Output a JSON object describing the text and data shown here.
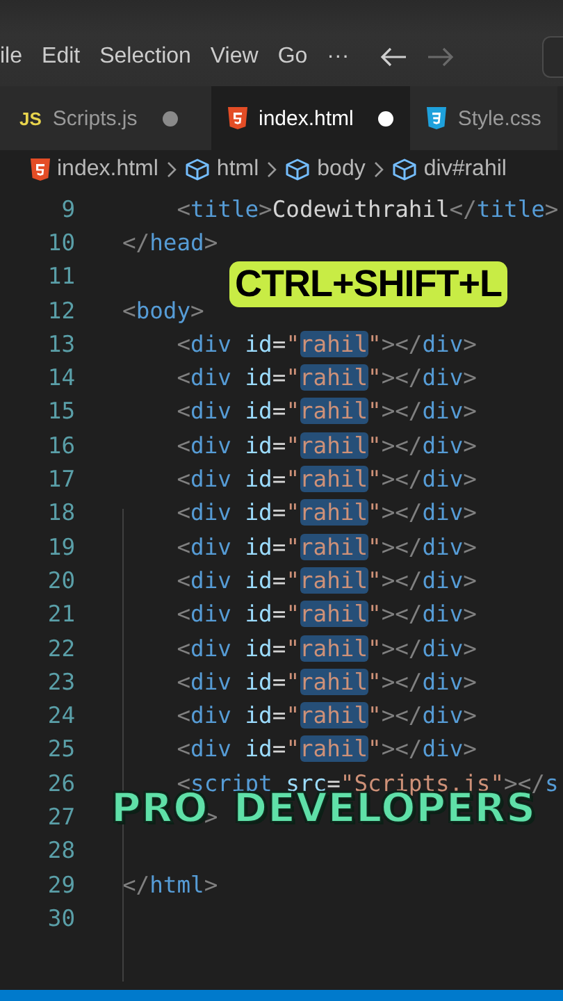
{
  "menu": {
    "items": [
      "ile",
      "Edit",
      "Selection",
      "View",
      "Go",
      "···"
    ],
    "back_enabled": true,
    "forward_enabled": false
  },
  "tabs": [
    {
      "label": "Scripts.js",
      "icon_text": "JS",
      "kind": "js",
      "selected": false,
      "modified": true
    },
    {
      "label": "index.html",
      "kind": "html",
      "selected": true,
      "modified": true
    },
    {
      "label": "Style.css",
      "kind": "css",
      "selected": false
    }
  ],
  "breadcrumb": [
    {
      "label": "index.html",
      "kind": "html"
    },
    {
      "label": "html",
      "kind": "element"
    },
    {
      "label": "body",
      "kind": "element"
    },
    {
      "label": "div#rahil",
      "kind": "element"
    }
  ],
  "editor": {
    "lines": [
      {
        "n": "9",
        "tokens": [
          {
            "kind": "punct",
            "text": "    <"
          },
          {
            "kind": "tag",
            "text": "title"
          },
          {
            "kind": "punct",
            "text": ">"
          },
          {
            "kind": "plain",
            "text": "Codewithrahil"
          },
          {
            "kind": "punct",
            "text": "</"
          },
          {
            "kind": "tag",
            "text": "title"
          },
          {
            "kind": "punct",
            "text": ">"
          }
        ]
      },
      {
        "n": "10",
        "tokens": [
          {
            "kind": "punct",
            "text": "</"
          },
          {
            "kind": "tag",
            "text": "head"
          },
          {
            "kind": "punct",
            "text": ">"
          }
        ]
      },
      {
        "n": "11"
      },
      {
        "n": "12",
        "tokens": [
          {
            "kind": "punct",
            "text": "<"
          },
          {
            "kind": "tag",
            "text": "body"
          },
          {
            "kind": "punct",
            "text": ">"
          }
        ]
      },
      {
        "n": "13",
        "tokens": [
          {
            "kind": "punct",
            "text": "    <"
          },
          {
            "kind": "tag",
            "text": "div"
          },
          {
            "kind": "attr",
            "text": " id"
          },
          {
            "kind": "plain",
            "text": "="
          },
          {
            "kind": "str",
            "text": "\""
          },
          {
            "kind": "sel",
            "text": "rahil"
          },
          {
            "kind": "str",
            "text": "\""
          },
          {
            "kind": "punct",
            "text": "></"
          },
          {
            "kind": "tag",
            "text": "div"
          },
          {
            "kind": "punct",
            "text": ">"
          }
        ]
      },
      {
        "n": "14",
        "tokens": [
          {
            "kind": "punct",
            "text": "    <"
          },
          {
            "kind": "tag",
            "text": "div"
          },
          {
            "kind": "attr",
            "text": " id"
          },
          {
            "kind": "plain",
            "text": "="
          },
          {
            "kind": "str",
            "text": "\""
          },
          {
            "kind": "sel",
            "text": "rahil"
          },
          {
            "kind": "str",
            "text": "\""
          },
          {
            "kind": "punct",
            "text": "></"
          },
          {
            "kind": "tag",
            "text": "div"
          },
          {
            "kind": "punct",
            "text": ">"
          }
        ]
      },
      {
        "n": "15",
        "tokens": [
          {
            "kind": "punct",
            "text": "    <"
          },
          {
            "kind": "tag",
            "text": "div"
          },
          {
            "kind": "attr",
            "text": " id"
          },
          {
            "kind": "plain",
            "text": "="
          },
          {
            "kind": "str",
            "text": "\""
          },
          {
            "kind": "sel",
            "text": "rahil"
          },
          {
            "kind": "str",
            "text": "\""
          },
          {
            "kind": "punct",
            "text": "></"
          },
          {
            "kind": "tag",
            "text": "div"
          },
          {
            "kind": "punct",
            "text": ">"
          }
        ]
      },
      {
        "n": "16",
        "tokens": [
          {
            "kind": "punct",
            "text": "    <"
          },
          {
            "kind": "tag",
            "text": "div"
          },
          {
            "kind": "attr",
            "text": " id"
          },
          {
            "kind": "plain",
            "text": "="
          },
          {
            "kind": "str",
            "text": "\""
          },
          {
            "kind": "sel",
            "text": "rahil"
          },
          {
            "kind": "str",
            "text": "\""
          },
          {
            "kind": "punct",
            "text": "></"
          },
          {
            "kind": "tag",
            "text": "div"
          },
          {
            "kind": "punct",
            "text": ">"
          }
        ]
      },
      {
        "n": "17",
        "tokens": [
          {
            "kind": "punct",
            "text": "    <"
          },
          {
            "kind": "tag",
            "text": "div"
          },
          {
            "kind": "attr",
            "text": " id"
          },
          {
            "kind": "plain",
            "text": "="
          },
          {
            "kind": "str",
            "text": "\""
          },
          {
            "kind": "sel",
            "text": "rahil"
          },
          {
            "kind": "str",
            "text": "\""
          },
          {
            "kind": "punct",
            "text": "></"
          },
          {
            "kind": "tag",
            "text": "div"
          },
          {
            "kind": "punct",
            "text": ">"
          }
        ]
      },
      {
        "n": "18",
        "tokens": [
          {
            "kind": "punct",
            "text": "    <"
          },
          {
            "kind": "tag",
            "text": "div"
          },
          {
            "kind": "attr",
            "text": " id"
          },
          {
            "kind": "plain",
            "text": "="
          },
          {
            "kind": "str",
            "text": "\""
          },
          {
            "kind": "sel",
            "text": "rahil"
          },
          {
            "kind": "str",
            "text": "\""
          },
          {
            "kind": "punct",
            "text": "></"
          },
          {
            "kind": "tag",
            "text": "div"
          },
          {
            "kind": "punct",
            "text": ">"
          }
        ]
      },
      {
        "n": "19",
        "tokens": [
          {
            "kind": "punct",
            "text": "    <"
          },
          {
            "kind": "tag",
            "text": "div"
          },
          {
            "kind": "attr",
            "text": " id"
          },
          {
            "kind": "plain",
            "text": "="
          },
          {
            "kind": "str",
            "text": "\""
          },
          {
            "kind": "sel",
            "text": "rahil"
          },
          {
            "kind": "str",
            "text": "\""
          },
          {
            "kind": "punct",
            "text": "></"
          },
          {
            "kind": "tag",
            "text": "div"
          },
          {
            "kind": "punct",
            "text": ">"
          }
        ]
      },
      {
        "n": "20",
        "tokens": [
          {
            "kind": "punct",
            "text": "    <"
          },
          {
            "kind": "tag",
            "text": "div"
          },
          {
            "kind": "attr",
            "text": " id"
          },
          {
            "kind": "plain",
            "text": "="
          },
          {
            "kind": "str",
            "text": "\""
          },
          {
            "kind": "sel",
            "text": "rahil"
          },
          {
            "kind": "str",
            "text": "\""
          },
          {
            "kind": "punct",
            "text": "></"
          },
          {
            "kind": "tag",
            "text": "div"
          },
          {
            "kind": "punct",
            "text": ">"
          }
        ]
      },
      {
        "n": "21",
        "tokens": [
          {
            "kind": "punct",
            "text": "    <"
          },
          {
            "kind": "tag",
            "text": "div"
          },
          {
            "kind": "attr",
            "text": " id"
          },
          {
            "kind": "plain",
            "text": "="
          },
          {
            "kind": "str",
            "text": "\""
          },
          {
            "kind": "sel",
            "text": "rahil"
          },
          {
            "kind": "str",
            "text": "\""
          },
          {
            "kind": "punct",
            "text": "></"
          },
          {
            "kind": "tag",
            "text": "div"
          },
          {
            "kind": "punct",
            "text": ">"
          }
        ]
      },
      {
        "n": "22",
        "tokens": [
          {
            "kind": "punct",
            "text": "    <"
          },
          {
            "kind": "tag",
            "text": "div"
          },
          {
            "kind": "attr",
            "text": " id"
          },
          {
            "kind": "plain",
            "text": "="
          },
          {
            "kind": "str",
            "text": "\""
          },
          {
            "kind": "sel",
            "text": "rahil"
          },
          {
            "kind": "str",
            "text": "\""
          },
          {
            "kind": "punct",
            "text": "></"
          },
          {
            "kind": "tag",
            "text": "div"
          },
          {
            "kind": "punct",
            "text": ">"
          }
        ]
      },
      {
        "n": "23",
        "tokens": [
          {
            "kind": "punct",
            "text": "    <"
          },
          {
            "kind": "tag",
            "text": "div"
          },
          {
            "kind": "attr",
            "text": " id"
          },
          {
            "kind": "plain",
            "text": "="
          },
          {
            "kind": "str",
            "text": "\""
          },
          {
            "kind": "sel",
            "text": "rahil"
          },
          {
            "kind": "str",
            "text": "\""
          },
          {
            "kind": "punct",
            "text": "></"
          },
          {
            "kind": "tag",
            "text": "div"
          },
          {
            "kind": "punct",
            "text": ">"
          }
        ]
      },
      {
        "n": "24",
        "tokens": [
          {
            "kind": "punct",
            "text": "    <"
          },
          {
            "kind": "tag",
            "text": "div"
          },
          {
            "kind": "attr",
            "text": " id"
          },
          {
            "kind": "plain",
            "text": "="
          },
          {
            "kind": "str",
            "text": "\""
          },
          {
            "kind": "sel",
            "text": "rahil"
          },
          {
            "kind": "str",
            "text": "\""
          },
          {
            "kind": "punct",
            "text": "></"
          },
          {
            "kind": "tag",
            "text": "div"
          },
          {
            "kind": "punct",
            "text": ">"
          }
        ]
      },
      {
        "n": "25",
        "tokens": [
          {
            "kind": "punct",
            "text": "    <"
          },
          {
            "kind": "tag",
            "text": "div"
          },
          {
            "kind": "attr",
            "text": " id"
          },
          {
            "kind": "plain",
            "text": "="
          },
          {
            "kind": "str",
            "text": "\""
          },
          {
            "kind": "sel",
            "text": "rahil"
          },
          {
            "kind": "str",
            "text": "\""
          },
          {
            "kind": "punct",
            "text": "></"
          },
          {
            "kind": "tag",
            "text": "div"
          },
          {
            "kind": "punct",
            "text": ">"
          }
        ]
      },
      {
        "n": "26",
        "tokens": [
          {
            "kind": "punct",
            "text": "    <"
          },
          {
            "kind": "tag",
            "text": "script"
          },
          {
            "kind": "attr",
            "text": " src"
          },
          {
            "kind": "plain",
            "text": "="
          },
          {
            "kind": "str",
            "text": "\"Scripts.js\""
          },
          {
            "kind": "punct",
            "text": "></"
          },
          {
            "kind": "tag",
            "text": "s"
          }
        ]
      },
      {
        "n": "27",
        "tokens": [
          {
            "kind": "punct",
            "text": "      >"
          }
        ]
      },
      {
        "n": "28"
      },
      {
        "n": "29",
        "tokens": [
          {
            "kind": "punct",
            "text": "</"
          },
          {
            "kind": "tag",
            "text": "html"
          },
          {
            "kind": "punct",
            "text": ">"
          }
        ]
      },
      {
        "n": "30"
      }
    ]
  },
  "captions": [
    {
      "text": "CTRL+SHIFT+L",
      "kind": "badge"
    },
    {
      "text": "PRO",
      "kind": "outlined"
    },
    {
      "text": "DEVELOPERS",
      "kind": "outlined"
    }
  ]
}
